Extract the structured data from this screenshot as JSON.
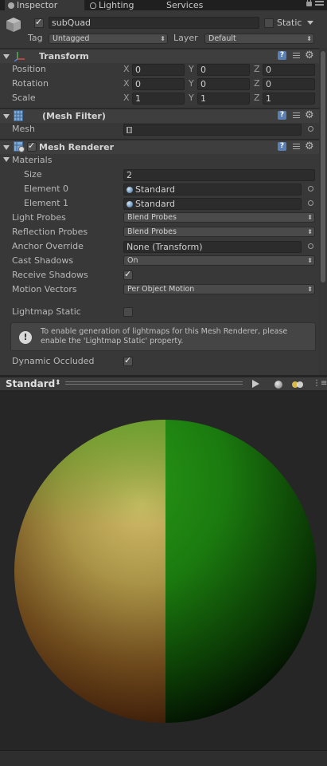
{
  "tabs": [
    {
      "label": "Inspector",
      "icon": "info-icon",
      "active": true
    },
    {
      "label": "Lighting",
      "icon": "bulb-icon",
      "active": false
    },
    {
      "label": "Services",
      "icon": "",
      "active": false
    }
  ],
  "object": {
    "name": "subQuad",
    "active": true,
    "static_label": "Static",
    "static_checked": false,
    "tag_label": "Tag",
    "tag_value": "Untagged",
    "layer_label": "Layer",
    "layer_value": "Default"
  },
  "transform": {
    "title": "Transform",
    "rows": [
      {
        "label": "Position",
        "x": "0",
        "y": "0",
        "z": "0"
      },
      {
        "label": "Rotation",
        "x": "0",
        "y": "0",
        "z": "0"
      },
      {
        "label": "Scale",
        "x": "1",
        "y": "1",
        "z": "1"
      }
    ],
    "axis_x": "X",
    "axis_y": "Y",
    "axis_z": "Z"
  },
  "mesh_filter": {
    "title": "(Mesh Filter)",
    "mesh_label": "Mesh",
    "mesh_value": ""
  },
  "mesh_renderer": {
    "title": "Mesh Renderer",
    "enabled": true,
    "materials_label": "Materials",
    "size_label": "Size",
    "size_value": "2",
    "element0_label": "Element 0",
    "element0_value": "Standard",
    "element1_label": "Element 1",
    "element1_value": "Standard",
    "light_probes_label": "Light Probes",
    "light_probes_value": "Blend Probes",
    "reflection_probes_label": "Reflection Probes",
    "reflection_probes_value": "Blend Probes",
    "anchor_override_label": "Anchor Override",
    "anchor_override_value": "None (Transform)",
    "cast_shadows_label": "Cast Shadows",
    "cast_shadows_value": "On",
    "receive_shadows_label": "Receive Shadows",
    "receive_shadows_checked": true,
    "motion_vectors_label": "Motion Vectors",
    "motion_vectors_value": "Per Object Motion",
    "lightmap_static_label": "Lightmap Static",
    "lightmap_static_checked": false,
    "help_text": "To enable generation of lightmaps for this Mesh Renderer, please enable the 'Lightmap Static' property.",
    "dynamic_occluded_label": "Dynamic Occluded",
    "dynamic_occluded_checked": true
  },
  "preview": {
    "title": "Standard"
  },
  "colors": {
    "panel_bg": "#383838",
    "field_bg": "#2c2c2c",
    "sphere_left": "#c9b25a",
    "sphere_right": "#1f8a12",
    "accent_help": "#5a7fb3"
  }
}
